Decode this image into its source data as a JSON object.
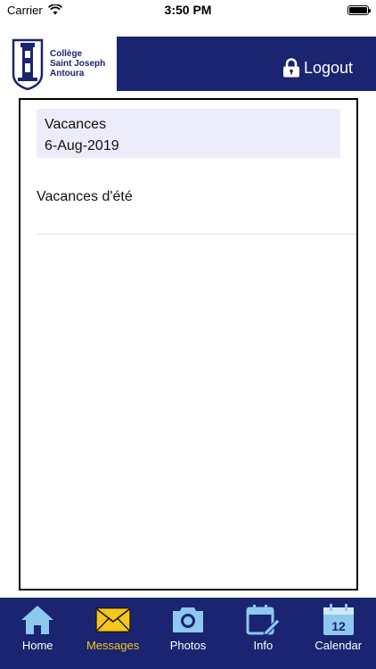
{
  "status_bar": {
    "carrier": "Carrier",
    "time": "3:50 PM"
  },
  "header": {
    "logo_lines": [
      "Collège",
      "Saint Joseph",
      "Antoura"
    ],
    "logout_label": "Logout"
  },
  "message": {
    "title": "Vacances",
    "date": "6-Aug-2019",
    "body": "Vacances d'été"
  },
  "tabs": [
    {
      "label": "Home",
      "icon": "home-icon",
      "active": false
    },
    {
      "label": "Messages",
      "icon": "envelope-icon",
      "active": true
    },
    {
      "label": "Photos",
      "icon": "camera-icon",
      "active": false
    },
    {
      "label": "Info",
      "icon": "edit-calendar-icon",
      "active": false
    },
    {
      "label": "Calendar",
      "icon": "calendar-icon",
      "active": false,
      "day": "12"
    }
  ],
  "colors": {
    "brand": "#1a2470",
    "active_tab": "#f6c619",
    "icon_light": "#8ec8ee",
    "card_bg": "#ececfa"
  }
}
